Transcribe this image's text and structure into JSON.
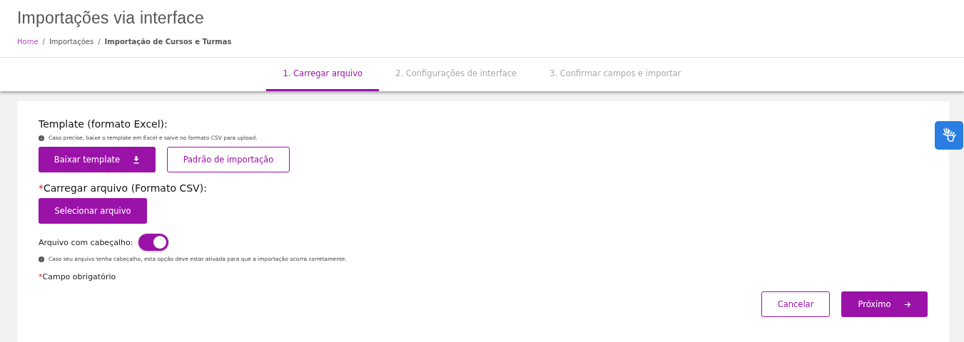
{
  "page_title": "Importações via interface",
  "breadcrumb": [
    {
      "label": "Home",
      "kind": "link"
    },
    {
      "label": "Importações",
      "kind": "plain"
    },
    {
      "label": "Importação de Cursos e Turmas",
      "kind": "current"
    }
  ],
  "breadcrumb_separator": "/",
  "steps": [
    {
      "label": "1. Carregar arquivo",
      "selected": true
    },
    {
      "label": "2. Configurações de interface",
      "selected": false
    },
    {
      "label": "3. Confirmar campos e importar",
      "selected": false
    }
  ],
  "template_section": {
    "title": "Template (formato Excel):",
    "hint": "Caso precise, baixe o template em Excel e salve no formato CSV para upload.",
    "download_button": "Baixar template",
    "pattern_button": "Padrão de importação"
  },
  "upload_section": {
    "required_mark": "*",
    "title": "Carregar arquivo (Formato CSV):",
    "select_button": "Selecionar arquivo"
  },
  "header_toggle": {
    "label": "Arquivo com cabeçalho:",
    "on": true,
    "hint": "Caso seu arquivo tenha cabeçalho, esta opção deve estar ativada para que a importação ocorra corretamente."
  },
  "required_note": {
    "mark": "*",
    "text": "Campo obrigatório"
  },
  "buttons": {
    "cancel": "Cancelar",
    "next": "Próximo"
  }
}
